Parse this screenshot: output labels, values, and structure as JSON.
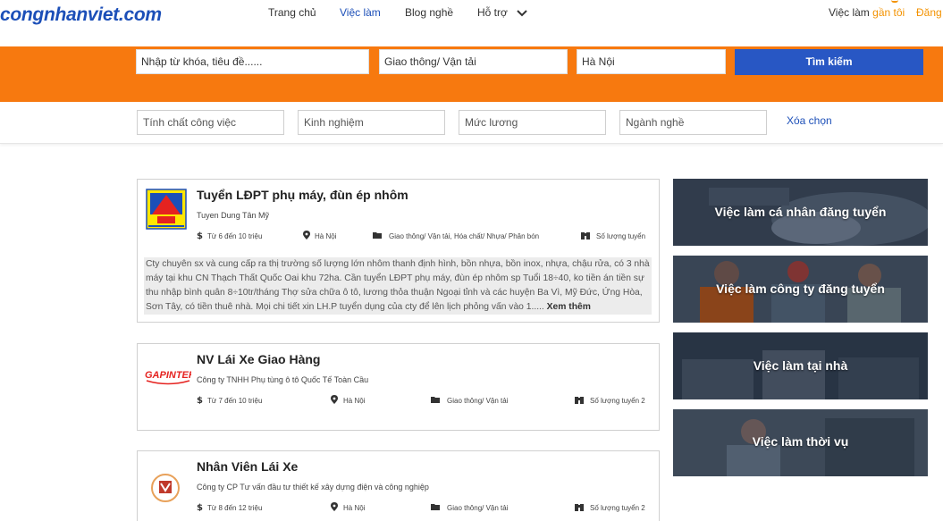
{
  "header": {
    "logo_text": "congnhanviet.com",
    "nav": [
      {
        "label": "Trang chủ",
        "active": false
      },
      {
        "label": "Việc làm",
        "active": true
      },
      {
        "label": "Blog nghề",
        "active": false
      },
      {
        "label": "Hỗ trợ",
        "active": false
      }
    ],
    "nearby_prefix": "Việc làm ",
    "nearby_accent": "gần tôi",
    "login": "Đăng"
  },
  "search": {
    "keyword_placeholder": "Nhập từ khóa, tiêu đề......",
    "category_value": "Giao thông/ Vận tải",
    "location_value": "Hà Nội",
    "button_label": "Tìm kiếm"
  },
  "filters": {
    "items": [
      "Tính chất công việc",
      "Kinh nghiệm",
      "Mức lương",
      "Ngành nghề"
    ],
    "clear_label": "Xóa chọn"
  },
  "jobs": [
    {
      "title": "Tuyển LĐPT phụ máy, đùn ép nhôm",
      "company": "Tuyen Dung Tân Mỹ",
      "salary": "Từ 6 đến 10 triệu",
      "location": "Hà Nội",
      "category": "Giao thông/ Vận tải, Hóa chất/ Nhựa/ Phân bón",
      "quantity": "Số lượng tuyển",
      "description": "Cty chuyên sx và cung cấp ra thị trường số lượng lớn nhôm thanh định hình, bồn nhựa, bồn inox, nhựa, chậu rửa, có 3 nhà máy tại khu CN Thạch Thất Quốc Oai khu 72ha. Cần tuyển LĐPT phụ máy, đùn ép nhôm sp Tuổi 18÷40, ko tiền án tiền sự thu nhập bình quân 8÷10tr/tháng Thợ sửa chữa ô tô, lương thỏa thuận Ngoại tỉnh và các huyện Ba Vì, Mỹ Đức, Ứng Hòa, Sơn Tây, có tiền thuê nhà. Mọi chi tiết xin LH.P tuyển dụng của cty để lên lịch phỏng vấn vào 1.....",
      "more": "Xem thêm"
    },
    {
      "title": "NV Lái Xe Giao Hàng",
      "company": "Công ty TNHH Phụ tùng ô tô Quốc Tế Toàn Cầu",
      "salary": "Từ 7 đến 10 triệu",
      "location": "Hà Nội",
      "category": "Giao thông/ Vận tải",
      "quantity": "Số lượng tuyển 2",
      "logo_text": "GAPINTER"
    },
    {
      "title": "Nhân Viên Lái Xe",
      "company": "Công ty CP Tư vấn đầu tư thiết kế xây dựng điện và công nghiệp",
      "salary": "Từ 8 đến 12 triệu",
      "location": "Hà Nội",
      "category": "Giao thông/ Vận tải",
      "quantity": "Số lượng tuyển 2"
    }
  ],
  "tiles": [
    {
      "label": "Việc làm cá nhân đăng tuyển"
    },
    {
      "label": "Việc làm công ty đăng tuyển"
    },
    {
      "label": "Việc làm tại nhà"
    },
    {
      "label": "Việc làm thời vụ"
    }
  ],
  "colors": {
    "brand_blue": "#1c4fb8",
    "orange": "#f7790f",
    "button_blue": "#2857c4"
  }
}
